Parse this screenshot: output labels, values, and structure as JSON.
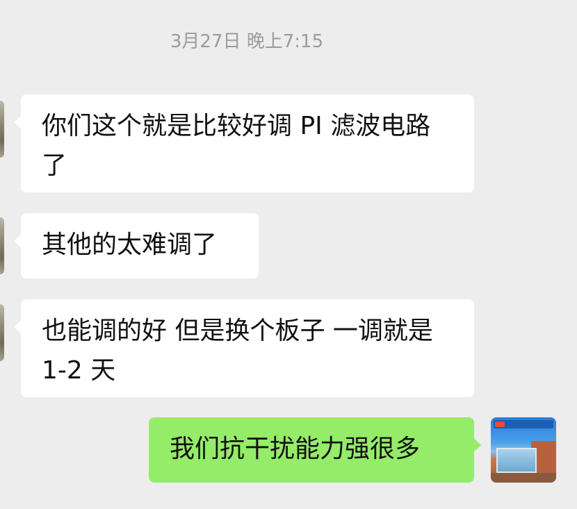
{
  "chat": {
    "timestamp": "3月27日 晚上7:15",
    "messages": [
      {
        "side": "left",
        "text": "你们这个就是比较好调 PI 滤波电路了"
      },
      {
        "side": "left",
        "text": "其他的太难调了"
      },
      {
        "side": "left",
        "text": "也能调的好  但是换个板子 一调就是 1-2 天"
      },
      {
        "side": "right",
        "text": "我们抗干扰能力强很多"
      }
    ]
  },
  "colors": {
    "background": "#ededed",
    "incoming_bubble": "#ffffff",
    "outgoing_bubble": "#95ec69",
    "timestamp": "#9b9b9b"
  },
  "icons": {
    "contact_avatar": "contact-avatar-icon",
    "self_avatar": "company-building-avatar-icon"
  }
}
